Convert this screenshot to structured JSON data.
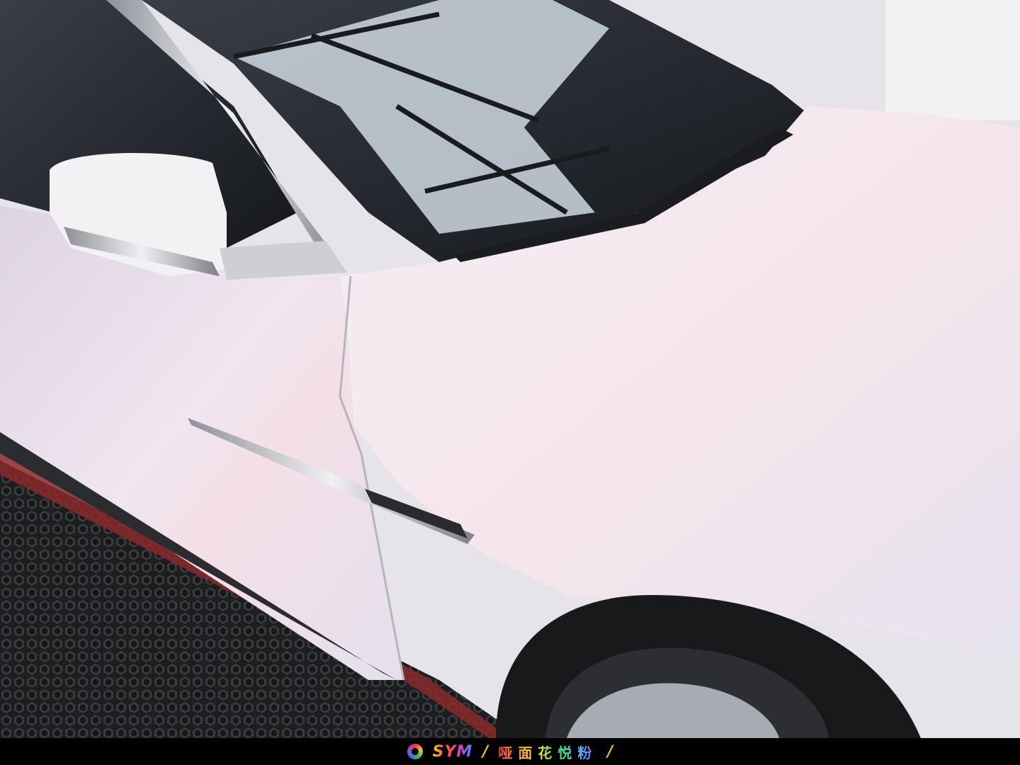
{
  "photo": {
    "subject": "car-front-fender-wrap",
    "colors": {
      "wrap_base": "#e9e2ec",
      "wrap_shimmer_pink": "#f3dce4",
      "glass": "#2a2d33",
      "floor_grate": "#232426",
      "floor_edge_red": "#8a2a2a",
      "chrome": "#c9ccd1",
      "tire": "#18191b"
    }
  },
  "caption": {
    "brand": "SYM",
    "slash_left": "/",
    "product": "哑面花悦粉",
    "slash_right": "/",
    "colors": {
      "background": "#000000",
      "slash_left": "#e8c21a",
      "slash_right": "#e8c21a"
    }
  }
}
